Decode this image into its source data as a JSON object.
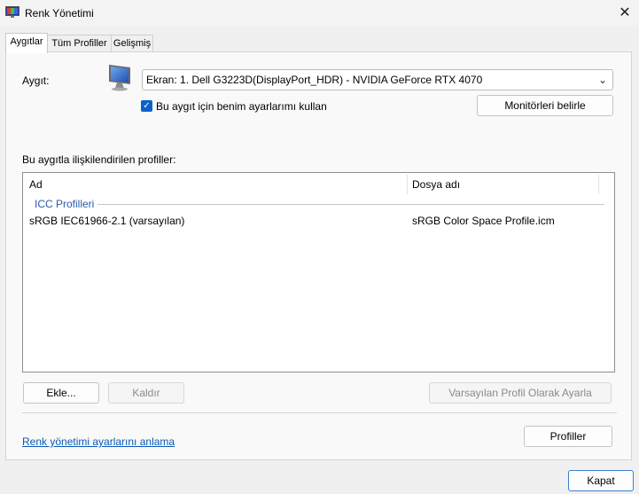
{
  "window": {
    "title": "Renk Yönetimi",
    "close_label": "✕"
  },
  "tabs": [
    {
      "label": "Aygıtlar",
      "active": true
    },
    {
      "label": "Tüm Profiller",
      "active": false
    },
    {
      "label": "Gelişmiş",
      "active": false
    }
  ],
  "device": {
    "label": "Aygıt:",
    "selected": "Ekran: 1. Dell G3223D(DisplayPort_HDR) - NVIDIA GeForce RTX 4070",
    "use_my_settings_label": "Bu aygıt için benim ayarlarımı kullan",
    "use_my_settings_checked": true,
    "identify_monitors_label": "Monitörleri belirle"
  },
  "profiles": {
    "section_label": "Bu aygıtla ilişkilendirilen profiller:",
    "columns": [
      "Ad",
      "Dosya adı"
    ],
    "group_label": "ICC Profilleri",
    "rows": [
      {
        "name": "sRGB IEC61966-2.1 (varsayılan)",
        "file": "sRGB Color Space Profile.icm"
      }
    ]
  },
  "actions": {
    "add_label": "Ekle...",
    "remove_label": "Kaldır",
    "set_default_label": "Varsayılan Profil Olarak Ayarla",
    "profiles_label": "Profiller"
  },
  "footer": {
    "link_label": "Renk yönetimi ayarlarını anlama",
    "close_label": "Kapat"
  },
  "colors": {
    "accent": "#0a62c9",
    "link": "#0a58b7",
    "group": "#2a59a8"
  }
}
